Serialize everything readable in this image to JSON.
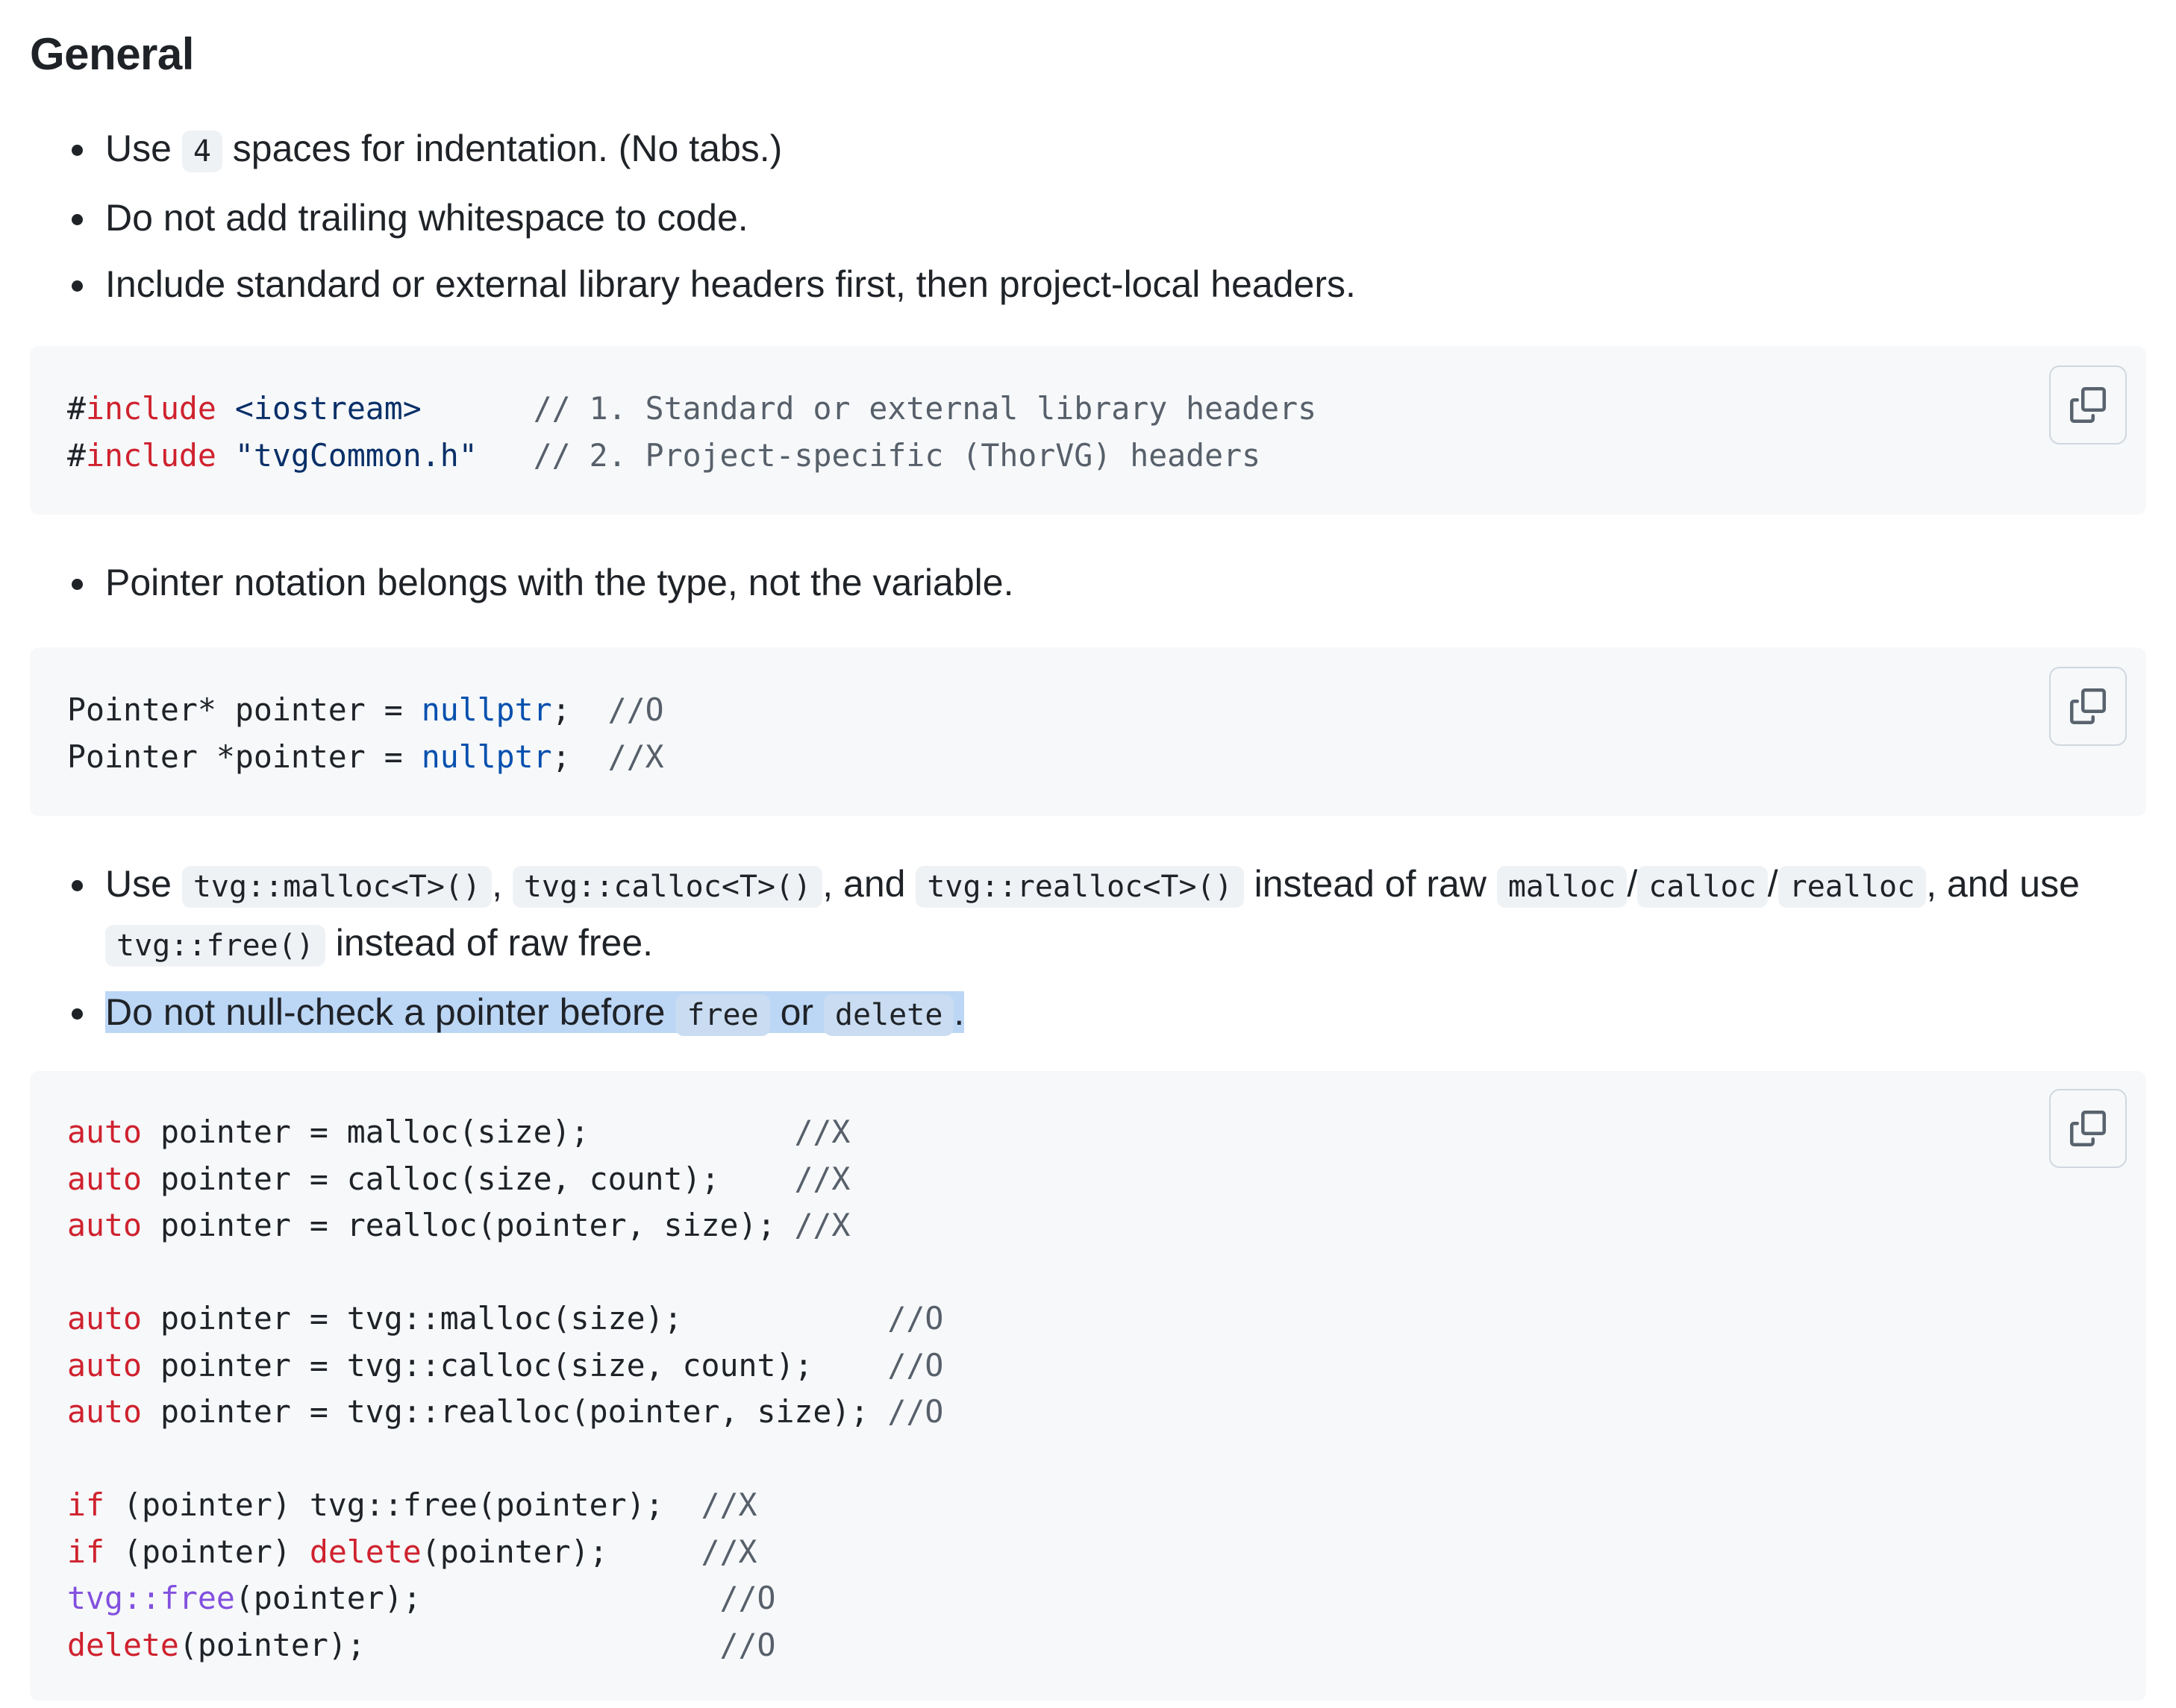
{
  "heading": "General",
  "list1": {
    "item1": {
      "before": "Use ",
      "code": "4",
      "after": " spaces for indentation. (No tabs.)"
    },
    "item2": "Do not add trailing whitespace to code.",
    "item3": "Include standard or external library headers first, then project-local headers."
  },
  "code1": {
    "l1": {
      "hash": "#",
      "kw": "include",
      "sp": " ",
      "str": "<iostream>",
      "pad": "      ",
      "cmt": "// 1. Standard or external library headers"
    },
    "l2": {
      "hash": "#",
      "kw": "include",
      "sp": " ",
      "str": "\"tvgCommon.h\"",
      "pad": "   ",
      "cmt": "// 2. Project-specific (ThorVG) headers"
    }
  },
  "list2": {
    "item1": "Pointer notation belongs with the type, not the variable."
  },
  "code2": {
    "l1": {
      "a": "Pointer* pointer = ",
      "b": "nullptr",
      "c": ";  ",
      "d": "//O"
    },
    "l2": {
      "a": "Pointer *pointer = ",
      "b": "nullptr",
      "c": ";  ",
      "d": "//X"
    }
  },
  "list3": {
    "item1": {
      "t1": "Use ",
      "c1": "tvg::malloc<T>()",
      "t2": ", ",
      "c2": "tvg::calloc<T>()",
      "t3": ", and ",
      "c3": "tvg::realloc<T>()",
      "t4": " instead of raw ",
      "c4": "malloc",
      "t5": "/",
      "c5": "calloc",
      "t6": "/",
      "c6": "realloc",
      "t7": ", and use ",
      "c7": "tvg::free()",
      "t8": " instead of raw free."
    },
    "item2": {
      "t1": "Do not null-check a pointer before ",
      "c1": "free",
      "t2": " or ",
      "c2": "delete",
      "t3": "."
    }
  },
  "code3": {
    "auto": "auto",
    "r1": {
      "a": " pointer = malloc(size);           ",
      "c": "//X"
    },
    "r2": {
      "a": " pointer = calloc(size, count);    ",
      "c": "//X"
    },
    "r3": {
      "a": " pointer = realloc(pointer, size); ",
      "c": "//X"
    },
    "t1": {
      "a": " pointer = tvg::malloc(size);           ",
      "c": "//O"
    },
    "t2": {
      "a": " pointer = tvg::calloc(size, count);    ",
      "c": "//O"
    },
    "t3": {
      "a": " pointer = tvg::realloc(pointer, size); ",
      "c": "//O"
    },
    "f1": {
      "kw": "if",
      "a": " (pointer) tvg::free(pointer);  ",
      "c": "//X"
    },
    "f2": {
      "kw": "if",
      "a": " (pointer) ",
      "kw2": "delete",
      "b": "(pointer);     ",
      "c": "//X"
    },
    "f3": {
      "fn": "tvg::free",
      "a": "(pointer);                ",
      "c": "//O"
    },
    "f4": {
      "kw": "delete",
      "a": "(pointer);                   ",
      "c": "//O"
    }
  },
  "icons": {
    "copy": "copy-icon"
  },
  "colors": {
    "keyword": "#cf222e",
    "string": "#0a3069",
    "comment": "#57606a",
    "constant": "#0550ae",
    "function": "#8250df",
    "selection": "#bcd6f5",
    "codeBackground": "#f6f8fa"
  }
}
